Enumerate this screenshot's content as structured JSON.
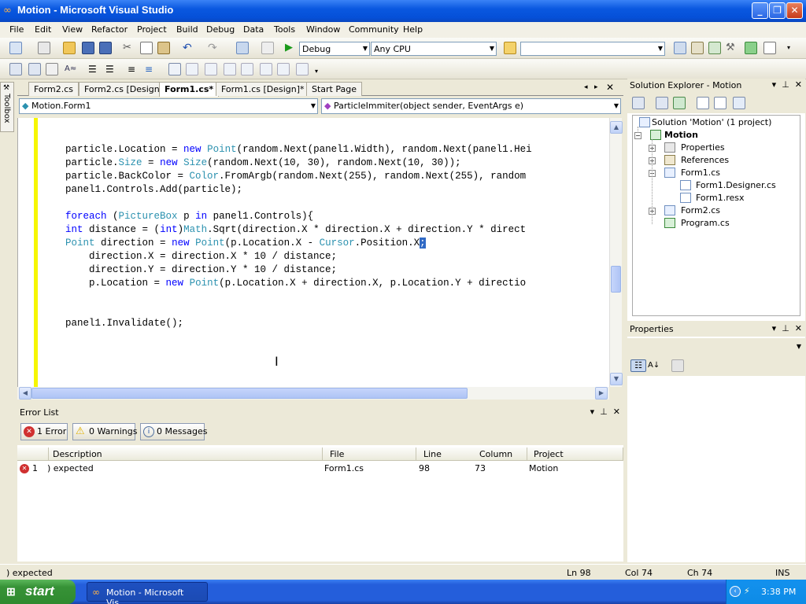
{
  "window": {
    "title": "Motion - Microsoft Visual Studio"
  },
  "menu": [
    "File",
    "Edit",
    "View",
    "Refactor",
    "Project",
    "Build",
    "Debug",
    "Data",
    "Tools",
    "Window",
    "Community",
    "Help"
  ],
  "toolbar": {
    "config": "Debug",
    "platform": "Any CPU",
    "find_value": ""
  },
  "sidebar_toolbox": "Toolbox",
  "tabs": [
    "Form2.cs",
    "Form2.cs [Design]",
    "Form1.cs*",
    "Form1.cs [Design]*",
    "Start Page"
  ],
  "nav": {
    "class": "Motion.Form1",
    "member": "ParticleImmiter(object sender, EventArgs e)"
  },
  "code": [
    {
      "text": "particle.Location = new Point(random.Next(panel1.Width), random.Next(panel1.Hei"
    },
    {
      "text": "particle.Size = new Size(random.Next(10, 30), random.Next(10, 30));"
    },
    {
      "text": "particle.BackColor = Color.FromArgb(random.Next(255), random.Next(255), random"
    },
    {
      "text": "panel1.Controls.Add(particle);"
    },
    {
      "text": "foreach (PictureBox p in panel1.Controls){"
    },
    {
      "text": "int distance = (int)Math.Sqrt(direction.X * direction.X + direction.Y * direct"
    },
    {
      "text": "Point direction = new Point(p.Location.X - Cursor.Position.X;"
    },
    {
      "text": "direction.X = direction.X * 10 / distance;"
    },
    {
      "text": "direction.Y = direction.Y * 10 / distance;"
    },
    {
      "text": "p.Location = new Point(p.Location.X + direction.X, p.Location.Y + directio"
    },
    {
      "text": "panel1.Invalidate();"
    }
  ],
  "error_list": {
    "title": "Error List",
    "filters": {
      "errors": "1 Error",
      "warnings": "0 Warnings",
      "messages": "0 Messages"
    },
    "columns": [
      "Description",
      "File",
      "Line",
      "Column",
      "Project"
    ],
    "rows": [
      {
        "num": "1",
        "description": ") expected",
        "file": "Form1.cs",
        "line": "98",
        "column": "73",
        "project": "Motion"
      }
    ]
  },
  "solution_explorer": {
    "title": "Solution Explorer - Motion",
    "solution": "Solution 'Motion' (1 project)",
    "project": "Motion",
    "items": [
      "Properties",
      "References",
      "Form1.cs",
      "Form1.Designer.cs",
      "Form1.resx",
      "Form2.cs",
      "Program.cs"
    ]
  },
  "properties": {
    "title": "Properties"
  },
  "status": {
    "message": ") expected",
    "ln": "Ln 98",
    "col": "Col 74",
    "ch": "Ch 74",
    "mode": "INS"
  },
  "taskbar": {
    "start": "start",
    "item": "Motion - Microsoft Vis...",
    "clock": "3:38 PM"
  }
}
